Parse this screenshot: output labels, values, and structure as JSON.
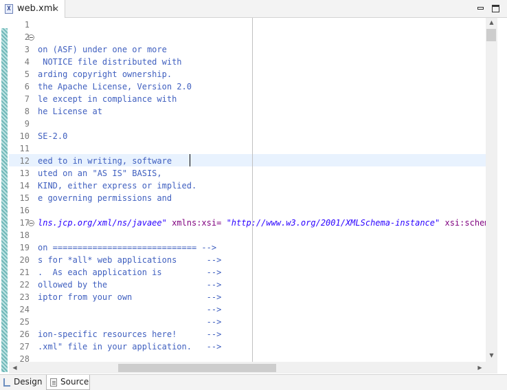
{
  "tab": {
    "icon": "xml-file-icon",
    "title": "web.xml",
    "close": "✕"
  },
  "window_buttons": {
    "minimize": "minimize-icon",
    "maximize": "maximize-icon"
  },
  "editor": {
    "line_numbers": [
      "1",
      "2",
      "3",
      "4",
      "5",
      "6",
      "7",
      "8",
      "9",
      "10",
      "11",
      "12",
      "13",
      "14",
      "15",
      "16",
      "17",
      "18",
      "19",
      "20",
      "21",
      "22",
      "23",
      "24",
      "25",
      "26",
      "27",
      "28"
    ],
    "lines": [
      "",
      "",
      "on (ASF) under one or more",
      " NOTICE file distributed with",
      "arding copyright ownership.",
      "the Apache License, Version 2.0",
      "le except in compliance with",
      "he License at",
      "",
      "SE-2.0",
      "",
      "eed to in writing, software",
      "uted on an \"AS IS\" BASIS,",
      "KIND, either express or implied.",
      "e governing permissions and",
      "",
      "",
      "",
      "on ============================= -->",
      "s for *all* web applications      -->",
      ".  As each application is         -->",
      "ollowed by the                    -->",
      "iptor from your own               -->",
      "                                  -->",
      "                                  -->",
      "ion-specific resources here!      -->",
      ".xml\" file in your application.   -->",
      ""
    ],
    "line17": {
      "value1": "lns.jcp.org/xml/ns/javaee\"",
      "attr2": "xmlns:xsi=",
      "value2": "\"http://www.w3.org/2001/XMLSchema-instance\"",
      "attr3": "xsi:schemaLoc"
    },
    "current_line": 12
  },
  "bottom_tabs": {
    "design": "Design",
    "source": "Source"
  }
}
